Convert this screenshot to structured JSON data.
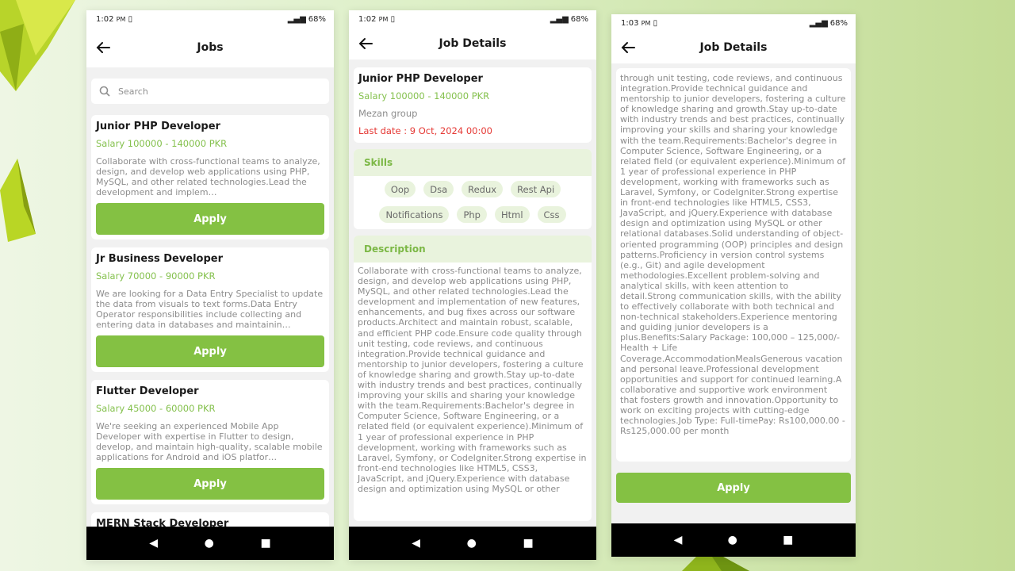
{
  "phone1": {
    "status": {
      "time": "1:02",
      "ampm": "PM",
      "battery": "68%"
    },
    "title": "Jobs",
    "search_placeholder": "Search",
    "jobs": [
      {
        "title": "Junior PHP Developer",
        "salary": "Salary 100000 - 140000 PKR",
        "description": "Collaborate with cross-functional teams to analyze, design, and develop web applications using PHP, MySQL, and other related technologies.Lead the development and implem…",
        "apply": "Apply"
      },
      {
        "title": "Jr Business Developer",
        "salary": "Salary 70000 - 90000 PKR",
        "description": "We are looking for a Data Entry Specialist to update the data from visuals to text forms.Data Entry Operator responsibilities include collecting and entering data in databases and maintainin…",
        "apply": "Apply"
      },
      {
        "title": "Flutter Developer",
        "salary": "Salary 45000 - 60000 PKR",
        "description": "We're seeking an experienced Mobile App Developer with expertise in Flutter to design, develop, and maintain high-quality, scalable mobile applications for Android and iOS platfor…",
        "apply": "Apply"
      },
      {
        "title": "MERN Stack Developer"
      }
    ]
  },
  "phone2": {
    "status": {
      "time": "1:02",
      "ampm": "PM",
      "battery": "68%"
    },
    "title": "Job Details",
    "job_title": "Junior PHP Developer",
    "salary": "Salary 100000 - 140000 PKR",
    "company": "Mezan group",
    "last_date": "Last date : 9 Oct, 2024 00:00",
    "skills_heading": "Skills",
    "skills": [
      "Oop",
      "Dsa",
      "Redux",
      "Rest Api",
      "Notifications",
      "Php",
      "Html",
      "Css"
    ],
    "description_heading": "Description",
    "description": "Collaborate with cross-functional teams to analyze, design, and develop web applications using PHP, MySQL, and other related technologies.Lead the development and implementation of new features, enhancements, and bug fixes across our software products.Architect and maintain robust, scalable, and efficient PHP code.Ensure code quality through unit testing, code reviews, and continuous integration.Provide technical guidance and mentorship to junior developers, fostering a culture of knowledge sharing and growth.Stay up-to-date with industry trends and best practices, continually improving your skills and sharing your knowledge with the team.Requirements:Bachelor's degree in Computer Science, Software Engineering, or a related field (or equivalent experience).Minimum of 1 year of professional experience in PHP development, working with frameworks such as Laravel, Symfony, or CodeIgniter.Strong expertise in front-end technologies like HTML5, CSS3, JavaScript, and jQuery.Experience with database design and optimization using MySQL or other"
  },
  "phone3": {
    "status": {
      "time": "1:03",
      "ampm": "PM",
      "battery": "68%"
    },
    "title": "Job Details",
    "description": "through unit testing, code reviews, and continuous integration.Provide technical guidance and mentorship to junior developers, fostering a culture of knowledge sharing and growth.Stay up-to-date with industry trends and best practices, continually improving your skills and sharing your knowledge with the team.Requirements:Bachelor's degree in Computer Science, Software Engineering, or a related field (or equivalent experience).Minimum of 1 year of professional experience in PHP development, working with frameworks such as Laravel, Symfony, or CodeIgniter.Strong expertise in front-end technologies like HTML5, CSS3, JavaScript, and jQuery.Experience with database design and optimization using MySQL or other relational databases.Solid understanding of object-oriented programming (OOP) principles and design patterns.Proficiency in version control systems (e.g., Git) and agile development methodologies.Excellent problem-solving and analytical skills, with keen attention to detail.Strong communication skills, with the ability to effectively collaborate with both technical and non-technical stakeholders.Experience mentoring and guiding junior developers is a plus.Benefits:Salary Package: 100,000 – 125,000/- Health + Life Coverage.AccommodationMealsGenerous vacation and personal leave.Professional development opportunities and support for continued learning.A collaborative and supportive work environment that fosters growth and innovation.Opportunity to work on exciting projects with cutting-edge technologies.Job Type: Full-timePay: Rs100,000.00 - Rs125,000.00 per month",
    "apply": "Apply"
  },
  "colors": {
    "accent_green": "#84c143",
    "salary_green": "#85c14e",
    "section_bg": "#e9f3dd",
    "last_date_red": "#e53935"
  },
  "icons": [
    "back-arrow-icon",
    "search-icon",
    "nav-back-icon",
    "nav-home-icon",
    "nav-recents-icon"
  ]
}
